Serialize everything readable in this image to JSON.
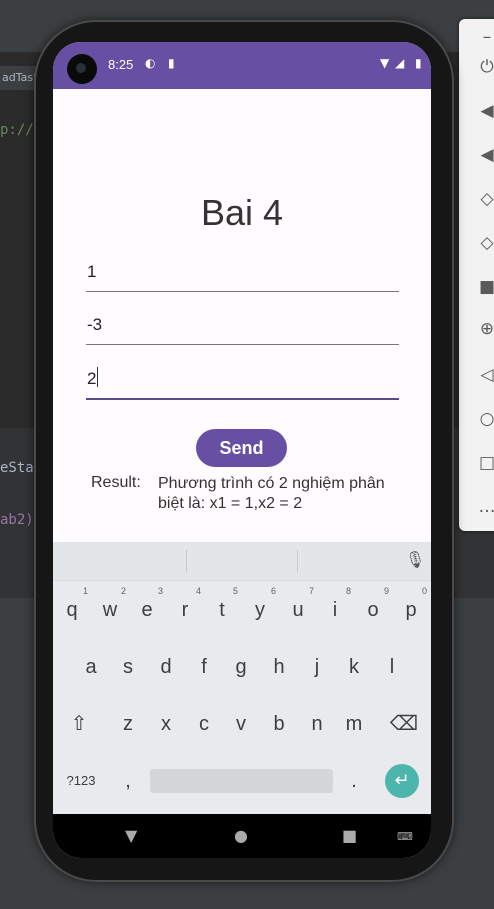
{
  "ide": {
    "tab_label": "adTask",
    "code_lines": [
      "p://",
      "eSta",
      "ab2)"
    ]
  },
  "status_bar": {
    "time": "8:25"
  },
  "app": {
    "title": "Bai 4",
    "inputs": {
      "a": "1",
      "b": "-3",
      "c": "2"
    },
    "send_label": "Send",
    "result_label": "Result:",
    "result_text": "Phương trình có 2 nghiệm phân biệt là: x1 = 1,x2 = 2"
  },
  "keyboard": {
    "row1": [
      "q",
      "w",
      "e",
      "r",
      "t",
      "y",
      "u",
      "i",
      "o",
      "p"
    ],
    "row1_hints": [
      "1",
      "2",
      "3",
      "4",
      "5",
      "6",
      "7",
      "8",
      "9",
      "0"
    ],
    "row2": [
      "a",
      "s",
      "d",
      "f",
      "g",
      "h",
      "j",
      "k",
      "l"
    ],
    "row3": [
      "z",
      "x",
      "c",
      "v",
      "b",
      "n",
      "m"
    ],
    "symbols_label": "?123",
    "comma": ",",
    "period": "."
  },
  "colors": {
    "accent": "#6750a4",
    "enter_key": "#4db6ac"
  }
}
